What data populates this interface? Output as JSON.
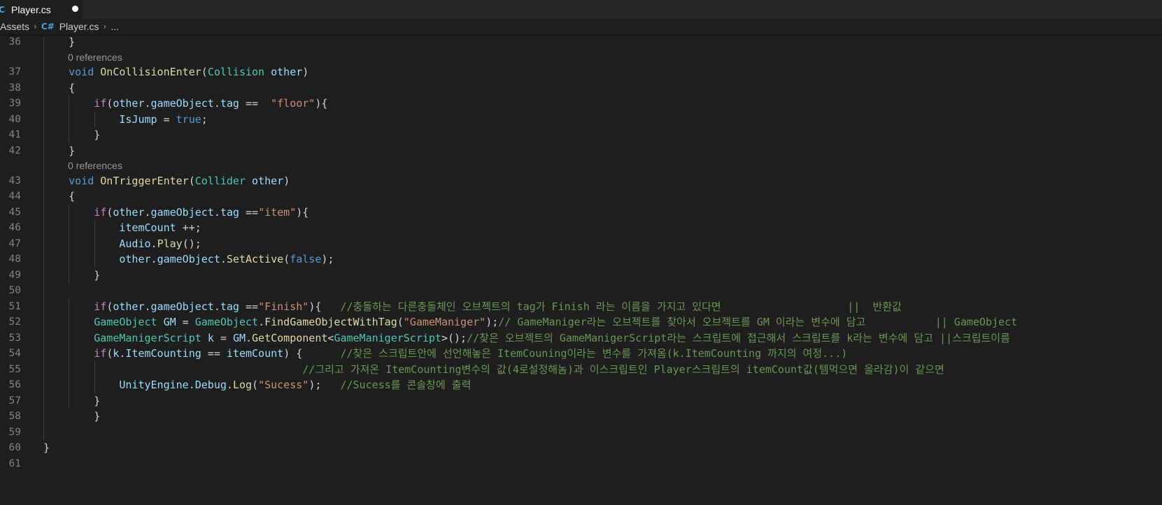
{
  "tab": {
    "icon": "csharp-file-icon",
    "label": "Player.cs",
    "modified": true
  },
  "breadcrumb": {
    "folder": "Assets",
    "file_icon": "csharp-file-icon",
    "file": "Player.cs",
    "more": "..."
  },
  "colors": {
    "keyword": "#569cd6",
    "control": "#c586c0",
    "type": "#4ec9b0",
    "function": "#dcdcaa",
    "variable": "#9cdcfe",
    "string": "#ce9178",
    "comment": "#6a9955",
    "text": "#d4d4d4"
  },
  "lines": [
    {
      "n": "36",
      "tokens": [
        [
          "pl",
          "    }"
        ]
      ]
    },
    {
      "lens": "0 references"
    },
    {
      "n": "37",
      "tokens": [
        [
          "pl",
          "    "
        ],
        [
          "kw",
          "void"
        ],
        [
          "pl",
          " "
        ],
        [
          "fn",
          "OnCollisionEnter"
        ],
        [
          "pl",
          "("
        ],
        [
          "ty",
          "Collision"
        ],
        [
          "pl",
          " "
        ],
        [
          "var",
          "other"
        ],
        [
          "pl",
          ")"
        ]
      ]
    },
    {
      "n": "38",
      "tokens": [
        [
          "pl",
          "    {"
        ]
      ]
    },
    {
      "n": "39",
      "tokens": [
        [
          "pl",
          "        "
        ],
        [
          "ctl",
          "if"
        ],
        [
          "pl",
          "("
        ],
        [
          "var",
          "other"
        ],
        [
          "pl",
          "."
        ],
        [
          "var",
          "gameObject"
        ],
        [
          "pl",
          "."
        ],
        [
          "var",
          "tag"
        ],
        [
          "pl",
          " ==  "
        ],
        [
          "str",
          "\"floor\""
        ],
        [
          "pl",
          "){"
        ]
      ]
    },
    {
      "n": "40",
      "tokens": [
        [
          "pl",
          "            "
        ],
        [
          "var",
          "IsJump"
        ],
        [
          "pl",
          " = "
        ],
        [
          "kw",
          "true"
        ],
        [
          "pl",
          ";"
        ]
      ]
    },
    {
      "n": "41",
      "tokens": [
        [
          "pl",
          "        }"
        ]
      ]
    },
    {
      "n": "42",
      "tokens": [
        [
          "pl",
          "    }"
        ]
      ]
    },
    {
      "lens": "0 references"
    },
    {
      "n": "43",
      "tokens": [
        [
          "pl",
          "    "
        ],
        [
          "kw",
          "void"
        ],
        [
          "pl",
          " "
        ],
        [
          "fn",
          "OnTriggerEnter"
        ],
        [
          "pl",
          "("
        ],
        [
          "ty",
          "Collider"
        ],
        [
          "pl",
          " "
        ],
        [
          "var",
          "other"
        ],
        [
          "pl",
          ")"
        ]
      ]
    },
    {
      "n": "44",
      "tokens": [
        [
          "pl",
          "    {"
        ]
      ]
    },
    {
      "n": "45",
      "tokens": [
        [
          "pl",
          "        "
        ],
        [
          "ctl",
          "if"
        ],
        [
          "pl",
          "("
        ],
        [
          "var",
          "other"
        ],
        [
          "pl",
          "."
        ],
        [
          "var",
          "gameObject"
        ],
        [
          "pl",
          "."
        ],
        [
          "var",
          "tag"
        ],
        [
          "pl",
          " =="
        ],
        [
          "str",
          "\"item\""
        ],
        [
          "pl",
          "){"
        ]
      ]
    },
    {
      "n": "46",
      "tokens": [
        [
          "pl",
          "            "
        ],
        [
          "var",
          "itemCount"
        ],
        [
          "pl",
          " ++;"
        ]
      ]
    },
    {
      "n": "47",
      "tokens": [
        [
          "pl",
          "            "
        ],
        [
          "var",
          "Audio"
        ],
        [
          "pl",
          "."
        ],
        [
          "fn",
          "Play"
        ],
        [
          "pl",
          "();"
        ]
      ]
    },
    {
      "n": "48",
      "tokens": [
        [
          "pl",
          "            "
        ],
        [
          "var",
          "other"
        ],
        [
          "pl",
          "."
        ],
        [
          "var",
          "gameObject"
        ],
        [
          "pl",
          "."
        ],
        [
          "fn",
          "SetActive"
        ],
        [
          "pl",
          "("
        ],
        [
          "kw",
          "false"
        ],
        [
          "pl",
          ");"
        ]
      ]
    },
    {
      "n": "49",
      "tokens": [
        [
          "pl",
          "        }"
        ]
      ]
    },
    {
      "n": "50",
      "tokens": []
    },
    {
      "n": "51",
      "tokens": [
        [
          "pl",
          "        "
        ],
        [
          "ctl",
          "if"
        ],
        [
          "pl",
          "("
        ],
        [
          "var",
          "other"
        ],
        [
          "pl",
          "."
        ],
        [
          "var",
          "gameObject"
        ],
        [
          "pl",
          "."
        ],
        [
          "var",
          "tag"
        ],
        [
          "pl",
          " =="
        ],
        [
          "str",
          "\"Finish\""
        ],
        [
          "pl",
          "){   "
        ],
        [
          "cm",
          "//충돌하는 다른충돌체인 오브젝트의 tag가 Finish 라는 이름을 가지고 있다면                    ||  반환값"
        ]
      ]
    },
    {
      "n": "52",
      "tokens": [
        [
          "pl",
          "        "
        ],
        [
          "ty",
          "GameObject"
        ],
        [
          "pl",
          " "
        ],
        [
          "var",
          "GM"
        ],
        [
          "pl",
          " = "
        ],
        [
          "ty",
          "GameObject"
        ],
        [
          "pl",
          "."
        ],
        [
          "fn",
          "FindGameObjectWithTag"
        ],
        [
          "pl",
          "("
        ],
        [
          "str",
          "\"GameManiger\""
        ],
        [
          "pl",
          ");"
        ],
        [
          "cm",
          "// GameManiger라는 오브젝트를 찾아서 오브젝트를 GM 이라는 변수에 담고           || GameObject"
        ]
      ]
    },
    {
      "n": "53",
      "tokens": [
        [
          "pl",
          "        "
        ],
        [
          "ty",
          "GameManigerScript"
        ],
        [
          "pl",
          " "
        ],
        [
          "var",
          "k"
        ],
        [
          "pl",
          " = "
        ],
        [
          "var",
          "GM"
        ],
        [
          "pl",
          "."
        ],
        [
          "fn",
          "GetComponent"
        ],
        [
          "pl",
          "<"
        ],
        [
          "ty",
          "GameManigerScript"
        ],
        [
          "pl",
          ">();"
        ],
        [
          "cm",
          "//찾은 오브젝트의 GameManigerScript라는 스크립트에 접근해서 스크립트를 k라는 변수에 담고 ||스크립트이름"
        ]
      ]
    },
    {
      "n": "54",
      "tokens": [
        [
          "pl",
          "        "
        ],
        [
          "ctl",
          "if"
        ],
        [
          "pl",
          "("
        ],
        [
          "var",
          "k"
        ],
        [
          "pl",
          "."
        ],
        [
          "var",
          "ItemCounting"
        ],
        [
          "pl",
          " == "
        ],
        [
          "var",
          "itemCount"
        ],
        [
          "pl",
          ") {      "
        ],
        [
          "cm",
          "//찾은 스크립트안에 선언해놓은 ItemCouning이라는 변수를 가져옴(k.ItemCounting 까지의 여정...)"
        ]
      ]
    },
    {
      "n": "55",
      "tokens": [
        [
          "pl",
          "                                         "
        ],
        [
          "cm",
          "//그리고 가져온 ItemCounting변수의 값(4로설정해놈)과 이스크립트인 Player스크립트의 itemCount값(템먹으면 올라감)이 같으면"
        ]
      ]
    },
    {
      "n": "56",
      "tokens": [
        [
          "pl",
          "            "
        ],
        [
          "var",
          "UnityEngine"
        ],
        [
          "pl",
          "."
        ],
        [
          "var",
          "Debug"
        ],
        [
          "pl",
          "."
        ],
        [
          "fn",
          "Log"
        ],
        [
          "pl",
          "("
        ],
        [
          "str",
          "\"Sucess\""
        ],
        [
          "pl",
          ");   "
        ],
        [
          "cm",
          "//Sucess를 콘솔창에 출력"
        ]
      ]
    },
    {
      "n": "57",
      "tokens": [
        [
          "pl",
          "        }"
        ]
      ]
    },
    {
      "n": "58",
      "tokens": [
        [
          "pl",
          "        }"
        ]
      ]
    },
    {
      "n": "59",
      "tokens": []
    },
    {
      "n": "60",
      "tokens": [
        [
          "pl",
          "}"
        ]
      ]
    },
    {
      "n": "61",
      "tokens": []
    }
  ]
}
